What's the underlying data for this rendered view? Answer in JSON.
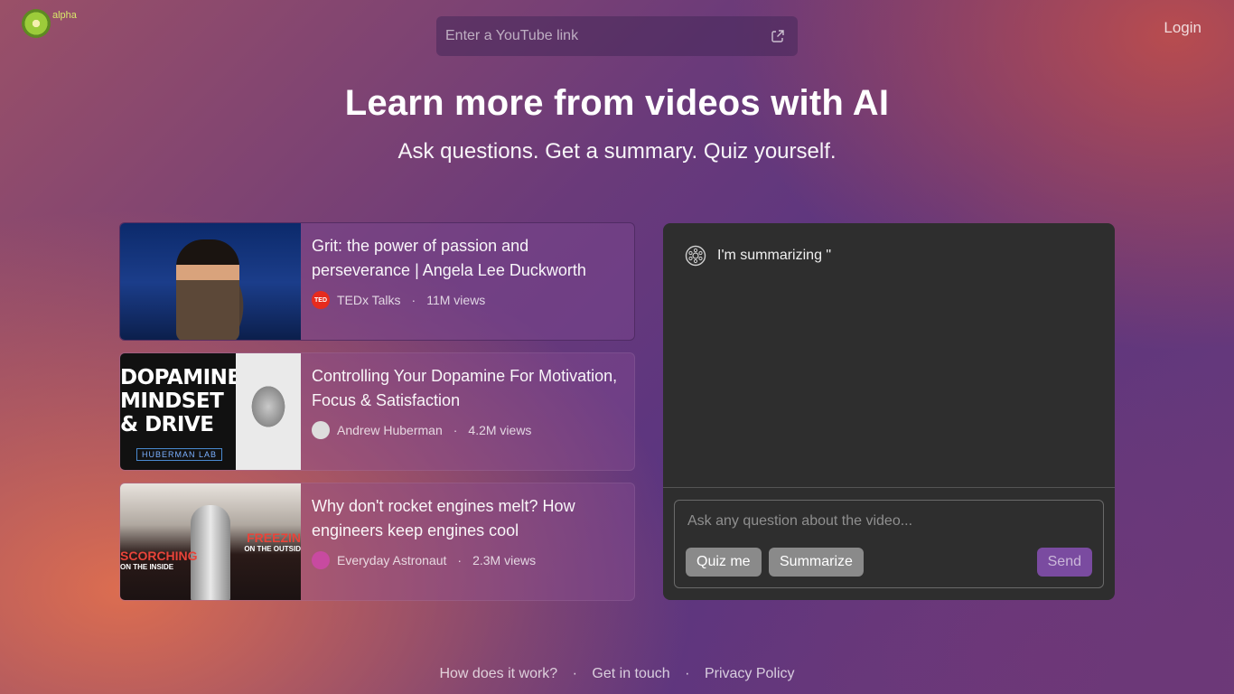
{
  "brand": {
    "badge": "alpha"
  },
  "search": {
    "placeholder": "Enter a YouTube link"
  },
  "header": {
    "login_label": "Login"
  },
  "hero": {
    "title": "Learn more from videos with AI",
    "subtitle": "Ask questions. Get a summary. Quiz yourself."
  },
  "videos": [
    {
      "title": "Grit: the power of passion and perseverance | Angela Lee Duckworth",
      "channel": "TEDx Talks",
      "channel_icon_text": "TED",
      "views": "11M views"
    },
    {
      "title": "Controlling Your Dopamine For Motivation, Focus & Satisfaction",
      "channel": "Andrew Huberman",
      "views": "4.2M views",
      "thumb_text": "DOPAMINE MINDSET & DRIVE",
      "thumb_badge": "HUBERMAN LAB"
    },
    {
      "title": "Why don't rocket engines melt? How engineers keep engines cool",
      "channel": "Everyday Astronaut",
      "views": "2.3M views",
      "thumb_left": "SCORCHING",
      "thumb_left_sub": "ON THE INSIDE",
      "thumb_right": "FREEZIN",
      "thumb_right_sub": "ON THE OUTSID"
    }
  ],
  "chat": {
    "message": "I'm summarizing \"",
    "input_placeholder": "Ask any question about the video...",
    "quiz_label": "Quiz me",
    "summarize_label": "Summarize",
    "send_label": "Send"
  },
  "footer": {
    "links": [
      "How does it work?",
      "Get in touch",
      "Privacy Policy"
    ],
    "separator": "·"
  },
  "colors": {
    "send_accent": "#7a4ba0",
    "ted_red": "#e62b1e"
  }
}
